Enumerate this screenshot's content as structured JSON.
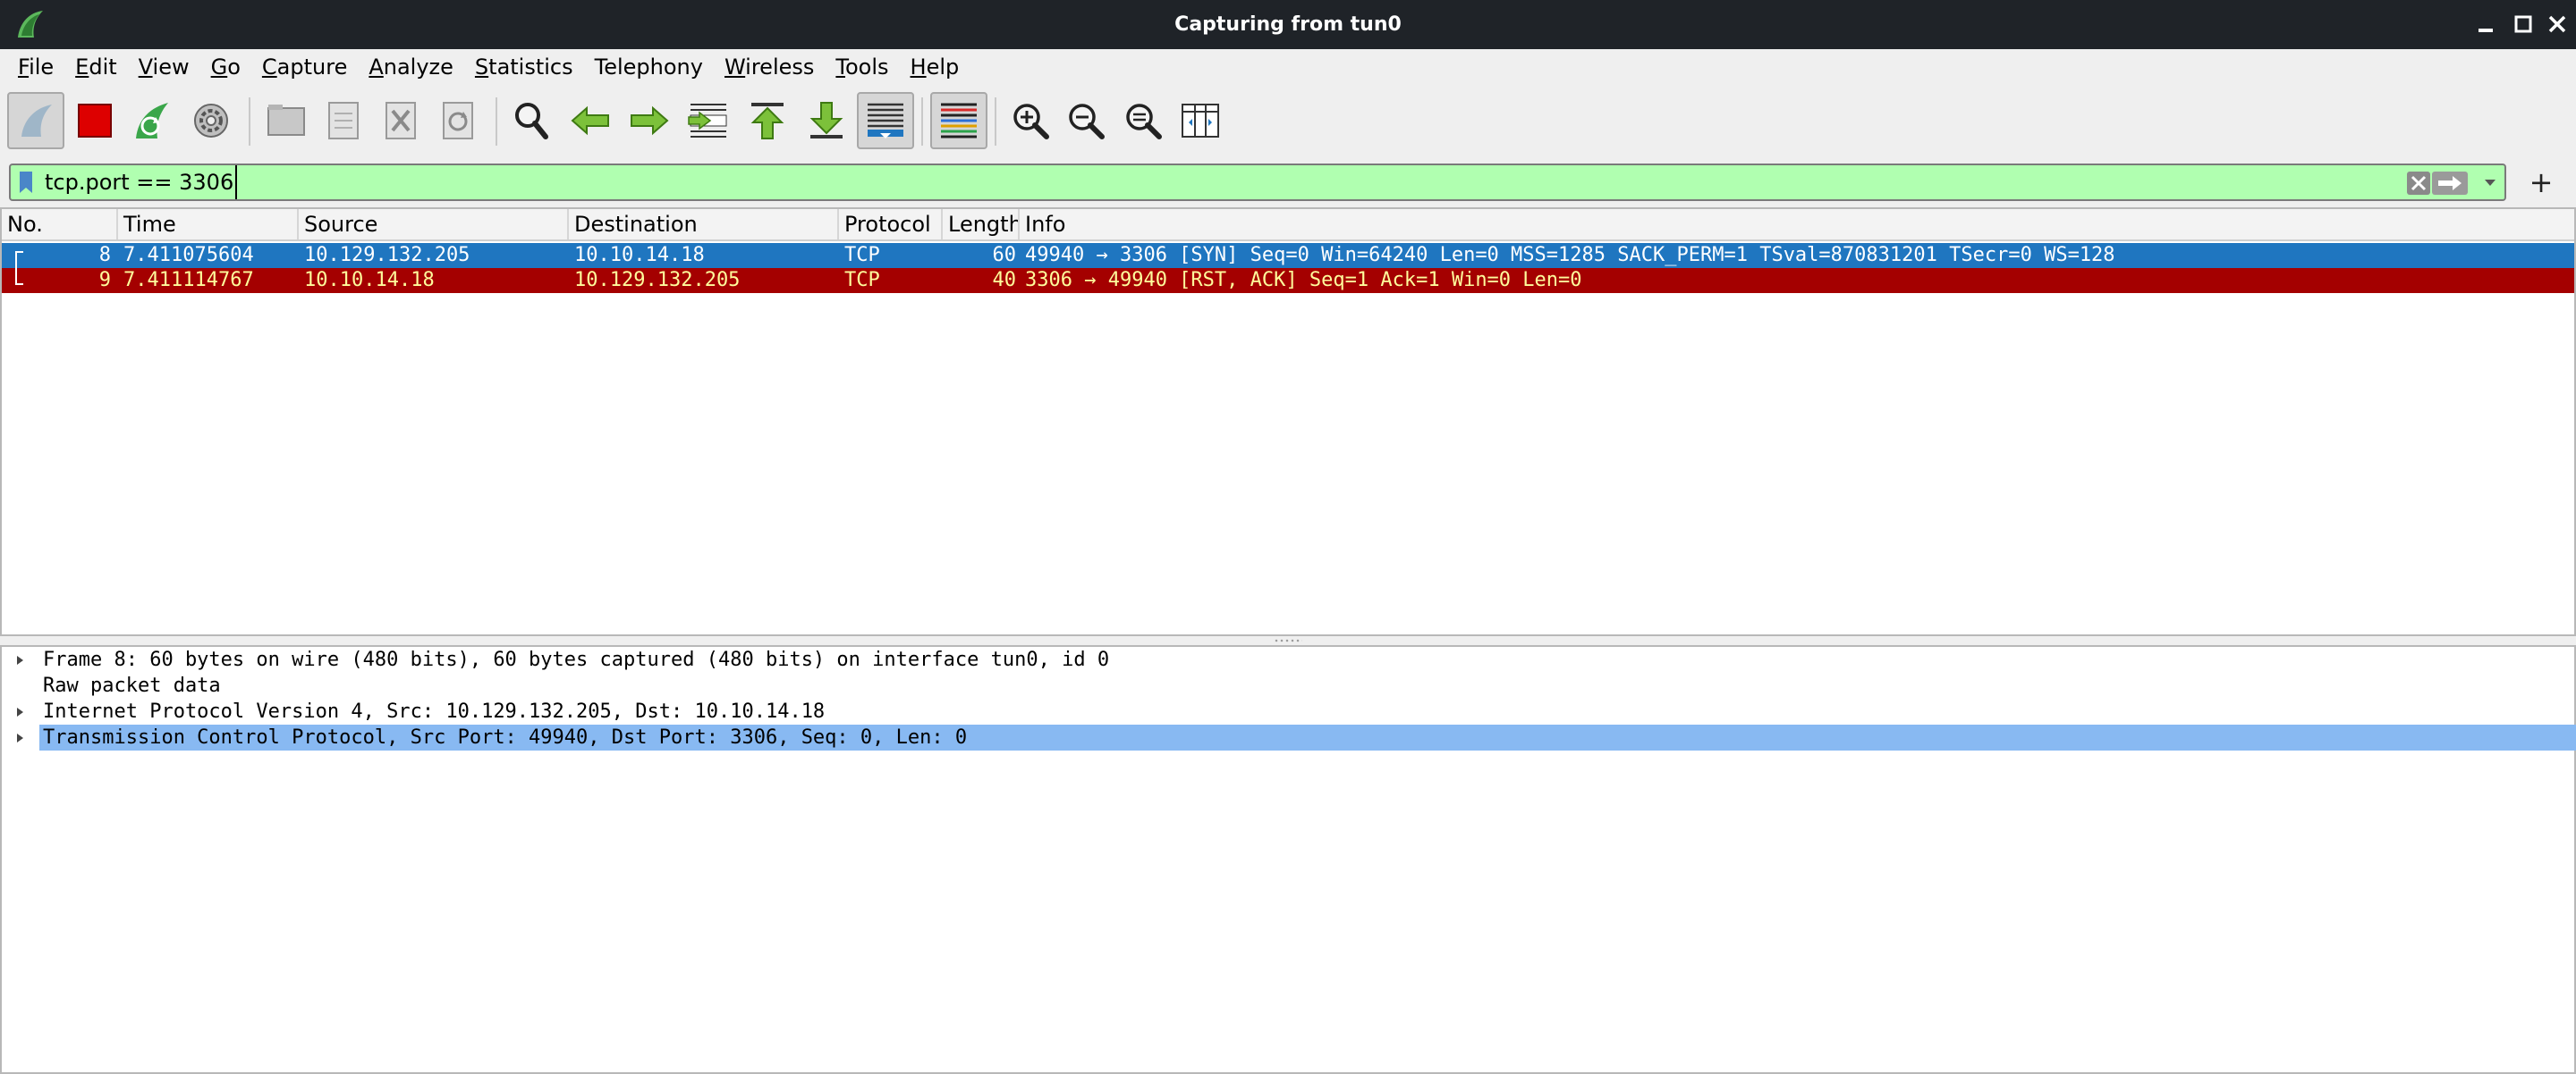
{
  "window": {
    "title": "Capturing from tun0"
  },
  "menu": [
    {
      "mnemonic": "F",
      "rest": "ile"
    },
    {
      "mnemonic": "E",
      "rest": "dit"
    },
    {
      "mnemonic": "V",
      "rest": "iew"
    },
    {
      "mnemonic": "G",
      "rest": "o"
    },
    {
      "mnemonic": "C",
      "rest": "apture"
    },
    {
      "mnemonic": "A",
      "rest": "nalyze"
    },
    {
      "mnemonic": "S",
      "rest": "tatistics"
    },
    {
      "mnemonic": "",
      "rest": "Telephony"
    },
    {
      "mnemonic": "W",
      "rest": "ireless"
    },
    {
      "mnemonic": "T",
      "rest": "ools"
    },
    {
      "mnemonic": "H",
      "rest": "elp"
    }
  ],
  "toolbar": {
    "icons": [
      "shark-fin-start-icon",
      "stop-capture-icon",
      "restart-capture-icon",
      "capture-options-icon",
      "open-file-icon",
      "save-file-icon",
      "close-file-icon",
      "reload-file-icon",
      "find-packet-icon",
      "go-back-icon",
      "go-forward-icon",
      "go-to-packet-icon",
      "first-packet-icon",
      "last-packet-icon",
      "autoscroll-icon",
      "colorize-icon",
      "zoom-in-icon",
      "zoom-out-icon",
      "normal-size-icon",
      "resize-columns-icon"
    ]
  },
  "filter": {
    "value": "tcp.port == 3306"
  },
  "packet_list": {
    "columns": [
      "No.",
      "Time",
      "Source",
      "Destination",
      "Protocol",
      "Length",
      "Info"
    ],
    "rows": [
      {
        "no": "8",
        "time": "7.411075604",
        "source": "10.129.132.205",
        "destination": "10.10.14.18",
        "protocol": "TCP",
        "length": "60",
        "info": "49940 → 3306 [SYN] Seq=0 Win=64240 Len=0 MSS=1285 SACK_PERM=1 TSval=870831201 TSecr=0 WS=128"
      },
      {
        "no": "9",
        "time": "7.411114767",
        "source": "10.10.14.18",
        "destination": "10.129.132.205",
        "protocol": "TCP",
        "length": "40",
        "info": "3306 → 49940 [RST, ACK] Seq=1 Ack=1 Win=0 Len=0"
      }
    ]
  },
  "details": {
    "tree": [
      "Frame 8: 60 bytes on wire (480 bits), 60 bytes captured (480 bits) on interface tun0, id 0",
      "Raw packet data",
      "Internet Protocol Version 4, Src: 10.129.132.205, Dst: 10.10.14.18",
      "Transmission Control Protocol, Src Port: 49940, Dst Port: 3306, Seq: 0, Len: 0"
    ]
  },
  "colors": {
    "selected_row": "#1f76c0",
    "rst_row": "#a40000",
    "rst_text": "#fffc9c",
    "filter_valid": "#b0ffb0",
    "detail_selected": "#88b9f2"
  }
}
